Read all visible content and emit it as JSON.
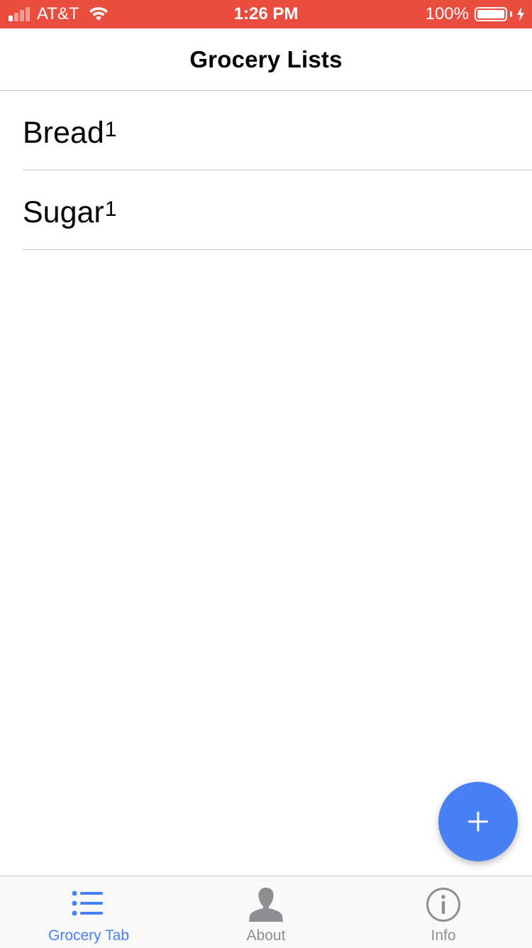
{
  "status_bar": {
    "carrier": "AT&T",
    "time": "1:26 PM",
    "battery_percent": "100%",
    "background_color": "#ea4c3d",
    "signal_bars_filled": 1,
    "signal_bars_total": 4
  },
  "nav": {
    "title": "Grocery Lists"
  },
  "list": {
    "items": [
      {
        "name": "Bread",
        "count": "1"
      },
      {
        "name": "Sugar",
        "count": "1"
      }
    ]
  },
  "fab": {
    "icon": "plus-icon",
    "color": "#4a80f5"
  },
  "tabs": [
    {
      "label": "Grocery Tab",
      "icon": "list-icon",
      "active": true
    },
    {
      "label": "About",
      "icon": "person-icon",
      "active": false
    },
    {
      "label": "Info",
      "icon": "info-icon",
      "active": false
    }
  ],
  "colors": {
    "active_tab": "#4a80f5",
    "inactive_tab": "#8e8e93"
  }
}
